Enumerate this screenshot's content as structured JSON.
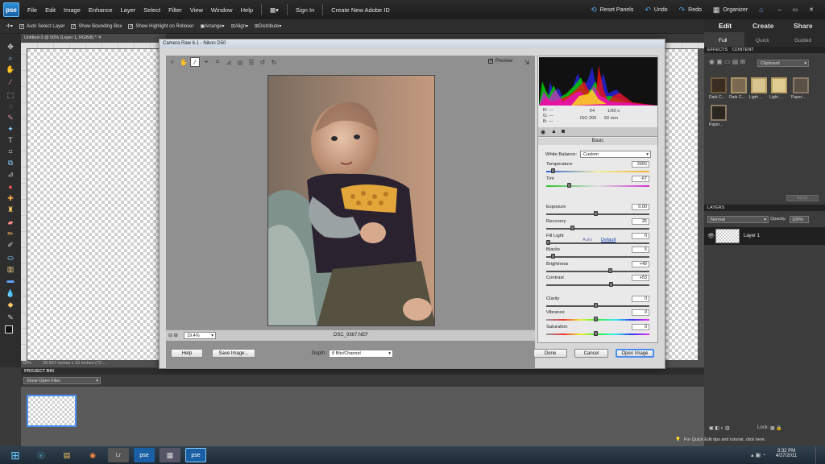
{
  "menubar": {
    "logo": "pse",
    "items": [
      "File",
      "Edit",
      "Image",
      "Enhance",
      "Layer",
      "Select",
      "Filter",
      "View",
      "Window",
      "Help"
    ],
    "sign_in": "Sign In",
    "create_id": "Create New Adobe ID",
    "reset_panels": "Reset Panels",
    "undo": "Undo",
    "redo": "Redo",
    "organizer": "Organizer"
  },
  "options_bar": {
    "auto_select": "Auto Select Layer",
    "bounding_box": "Show Bounding Box",
    "highlight": "Show Highlight on Rollover",
    "arrange": "Arrange",
    "align": "Align",
    "distribute": "Distribute"
  },
  "panel_tabs": {
    "edit": "Edit",
    "create": "Create",
    "share": "Share",
    "full": "Full",
    "quick": "Quick",
    "guided": "Guided"
  },
  "document": {
    "tab": "Untitled-3 @ 50% (Layer 1, RGB/8) *",
    "zoom": "50%",
    "size": "26.667 inches x 15 inches (72 ..."
  },
  "project_bin": {
    "header": "PROJECT BIN",
    "dropdown": "Show Open Files"
  },
  "effects_panel": {
    "tab_effects": "EFFECTS",
    "tab_content": "CONTENT",
    "category": "Clipboard",
    "thumbs": [
      "Dark C...",
      "Dark C...",
      "Light ...",
      "Light ...",
      "Paper...",
      "Paper..."
    ],
    "apply": "Apply"
  },
  "layers_panel": {
    "header": "LAYERS",
    "blend_mode": "Normal",
    "opacity_label": "Opacity:",
    "opacity": "100%",
    "layer_name": "Layer 1",
    "lock_label": "Lock:"
  },
  "camera_raw": {
    "title": "Camera Raw 6.1  -  Nikon D50",
    "preview_label": "Preview",
    "filename": "DSC_9367.NEF",
    "zoom": "19.4%",
    "exif": {
      "r": "R:  ---",
      "g": "G:  ---",
      "b": "B:  ---",
      "aperture": "f/4",
      "shutter": "1/60 s",
      "iso": "ISO 200",
      "focal": "50 mm"
    },
    "panel_title": "Basic",
    "white_balance_label": "White Balance:",
    "white_balance": "Custom",
    "auto": "Auto",
    "default": "Default",
    "sliders": [
      {
        "label": "Temperature",
        "value": "2650",
        "pos": 0.05
      },
      {
        "label": "Tint",
        "value": "-67",
        "pos": 0.22
      },
      {
        "label": "Exposure",
        "value": "0.00",
        "pos": 0.5
      },
      {
        "label": "Recovery",
        "value": "25",
        "pos": 0.25
      },
      {
        "label": "Fill Light",
        "value": "0",
        "pos": 0.0
      },
      {
        "label": "Blacks",
        "value": "5",
        "pos": 0.05
      },
      {
        "label": "Brightness",
        "value": "+49",
        "pos": 0.65
      },
      {
        "label": "Contrast",
        "value": "+53",
        "pos": 0.66
      },
      {
        "label": "Clarity",
        "value": "0",
        "pos": 0.5
      },
      {
        "label": "Vibrance",
        "value": "0",
        "pos": 0.5
      },
      {
        "label": "Saturation",
        "value": "0",
        "pos": 0.5
      }
    ],
    "buttons": {
      "help": "Help",
      "save": "Save Image...",
      "depth_label": "Depth:",
      "depth": "8 Bits/Channel",
      "done": "Done",
      "cancel": "Cancel",
      "open": "Open Image"
    }
  },
  "tip": "For Quick Edit tips and tutorial, click here.",
  "clock": {
    "time": "3:32 PM",
    "date": "4/27/2011"
  }
}
